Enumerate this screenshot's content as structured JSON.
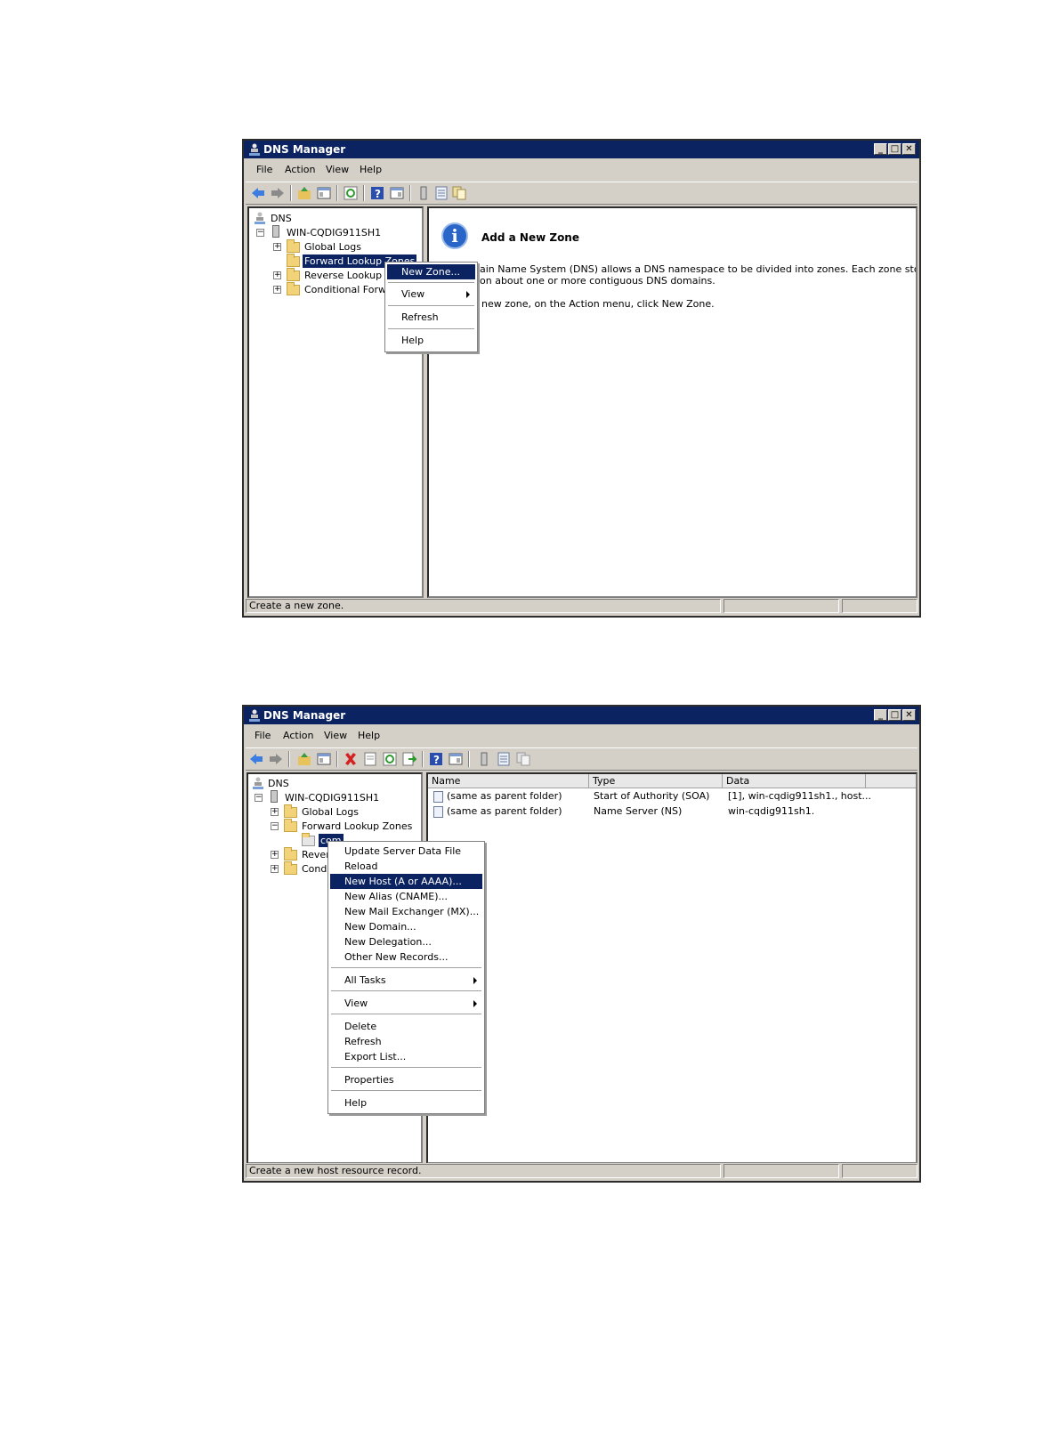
{
  "window1": {
    "title": "DNS Manager",
    "menu": [
      "File",
      "Action",
      "View",
      "Help"
    ],
    "tree": {
      "root": "DNS",
      "server": "WIN-CQDIG911SH1",
      "global_logs": "Global Logs",
      "forward_zones": "Forward Lookup Zones",
      "reverse_zones": "Reverse Lookup Zc",
      "conditional": "Conditional Forwar"
    },
    "context_menu": {
      "new_zone": "New Zone...",
      "view": "View",
      "refresh": "Refresh",
      "help": "Help"
    },
    "info": {
      "title": "Add a New Zone",
      "line1": "ain Name System (DNS) allows a DNS namespace to be divided into zones. Each zone stores",
      "line2": "on about one or more contiguous DNS domains.",
      "line3": "new zone, on the Action menu, click New Zone."
    },
    "status": "Create a new zone."
  },
  "window2": {
    "title": "DNS Manager",
    "menu": [
      "File",
      "Action",
      "View",
      "Help"
    ],
    "tree": {
      "root": "DNS",
      "server": "WIN-CQDIG911SH1",
      "global_logs": "Global Logs",
      "forward_zones": "Forward Lookup Zones",
      "com": "com",
      "reverse_zones": "Rever",
      "conditional": "Condi"
    },
    "columns": [
      "Name",
      "Type",
      "Data"
    ],
    "records": [
      {
        "name": "(same as parent folder)",
        "type": "Start of Authority (SOA)",
        "data": "[1], win-cqdig911sh1., host..."
      },
      {
        "name": "(same as parent folder)",
        "type": "Name Server (NS)",
        "data": "win-cqdig911sh1."
      }
    ],
    "context_menu": {
      "update": "Update Server Data File",
      "reload": "Reload",
      "new_host": "New Host (A or AAAA)...",
      "new_alias": "New Alias (CNAME)...",
      "new_mx": "New Mail Exchanger (MX)...",
      "new_domain": "New Domain...",
      "new_delegation": "New Delegation...",
      "other_records": "Other New Records...",
      "all_tasks": "All Tasks",
      "view": "View",
      "delete": "Delete",
      "refresh": "Refresh",
      "export": "Export List...",
      "properties": "Properties",
      "help": "Help"
    },
    "status": "Create a new host resource record."
  },
  "colors": {
    "title_bar": "#0b2360",
    "selection": "#0b2360",
    "chrome": "#d4d0c8",
    "info_icon": "#2a66c8"
  }
}
